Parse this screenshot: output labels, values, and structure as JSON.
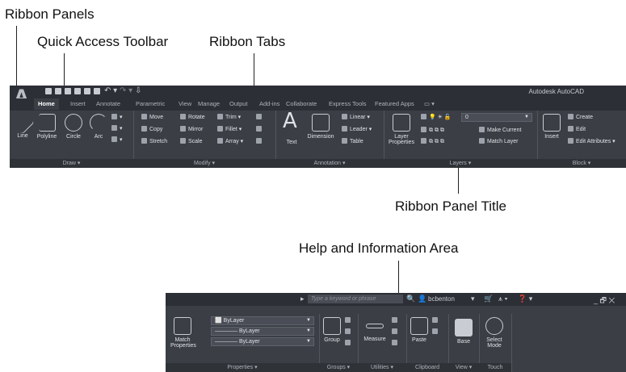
{
  "callouts": {
    "ribbon_panels": "Ribbon Panels",
    "quick_access_toolbar": "Quick Access Toolbar",
    "ribbon_tabs": "Ribbon Tabs",
    "ribbon_panel_title": "Ribbon Panel Title",
    "help_info_area": "Help and Information Area"
  },
  "app": {
    "logo": "A",
    "title": "Autodesk AutoCAD"
  },
  "tabs": [
    "Home",
    "Insert",
    "Annotate",
    "Parametric",
    "View",
    "Manage",
    "Output",
    "Add-ins",
    "Collaborate",
    "Express Tools",
    "Featured Apps"
  ],
  "tab_extra": "▭ ▾",
  "draw": {
    "title": "Draw ▾",
    "line": "Line",
    "polyline": "Polyline",
    "circle": "Circle",
    "arc": "Arc"
  },
  "modify": {
    "title": "Modify ▾",
    "move": "Move",
    "rotate": "Rotate",
    "trim": "Trim ▾",
    "copy": "Copy",
    "mirror": "Mirror",
    "fillet": "Fillet ▾",
    "stretch": "Stretch",
    "scale": "Scale",
    "array": "Array ▾"
  },
  "annotation": {
    "title": "Annotation ▾",
    "text": "Text",
    "dimension": "Dimension",
    "linear": "Linear ▾",
    "leader": "Leader ▾",
    "table": "Table"
  },
  "layers": {
    "title": "Layers ▾",
    "layer_properties_line1": "Layer",
    "layer_properties_line2": "Properties",
    "layer_value": "0",
    "make_current": "Make Current",
    "match_layer": "Match Layer"
  },
  "block": {
    "title": "Block ▾",
    "insert": "Insert",
    "create": "Create",
    "edit": "Edit",
    "edit_attributes": "Edit Attributes ▾"
  },
  "info_bar": {
    "search_placeholder": "Type a keyword or phrase",
    "user": "bcbenton",
    "window_controls": "_ 🗗 ✕"
  },
  "properties": {
    "title": "Properties ▾",
    "match_line1": "Match",
    "match_line2": "Properties",
    "color_value": "ByLayer",
    "linetype_value": "ByLayer",
    "lineweight_value": "ByLayer"
  },
  "groups": {
    "title": "Groups ▾",
    "group": "Group"
  },
  "utilities": {
    "title": "Utilities ▾",
    "measure": "Measure"
  },
  "clipboard": {
    "title": "Clipboard",
    "paste": "Paste"
  },
  "view": {
    "title": "View ▾",
    "base": "Base"
  },
  "touch": {
    "title": "Touch",
    "select_line1": "Select",
    "select_line2": "Mode"
  }
}
